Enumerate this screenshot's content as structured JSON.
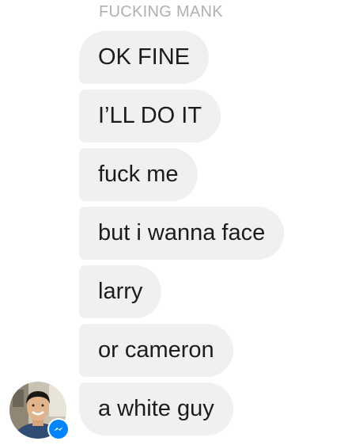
{
  "conversation": {
    "sender_name": "FUCKING MANK",
    "messages": [
      {
        "text": "OK FINE"
      },
      {
        "text": "I’LL DO IT"
      },
      {
        "text": "fuck me"
      },
      {
        "text": "but i wanna face"
      },
      {
        "text": "larry"
      },
      {
        "text": "or cameron"
      },
      {
        "text": "a white guy"
      }
    ]
  },
  "icons": {
    "avatar": "avatar",
    "badge": "messenger-icon"
  },
  "colors": {
    "bubble_background": "#f1f0f0",
    "bubble_text": "#1c1c1c",
    "sender_name_text": "#b0b0b0",
    "messenger_badge": "#0084ff"
  }
}
